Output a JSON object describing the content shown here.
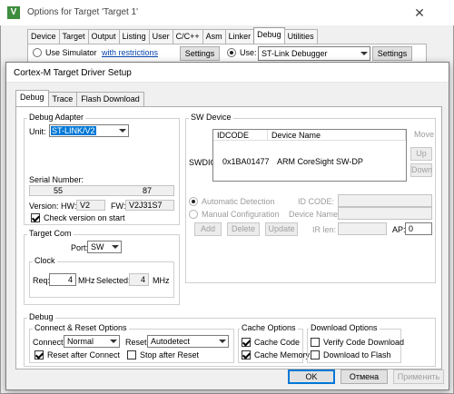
{
  "parent": {
    "title": "Options for Target 'Target 1'",
    "close": "✕",
    "tabs": [
      "Device",
      "Target",
      "Output",
      "Listing",
      "User",
      "C/C++",
      "Asm",
      "Linker",
      "Debug",
      "Utilities"
    ],
    "active_tab": "Debug",
    "use_simulator_label": "Use Simulator",
    "with_restrictions_link": "with restrictions",
    "settings_left": "Settings",
    "use_label": "Use:",
    "debugger": "ST-Link Debugger",
    "settings_right": "Settings"
  },
  "dialog": {
    "title": "Cortex-M Target Driver Setup",
    "tabs": [
      "Debug",
      "Trace",
      "Flash Download"
    ],
    "active_tab": "Debug",
    "debug_adapter": {
      "group": "Debug Adapter",
      "unit_label": "Unit:",
      "unit_value": "ST-LINK/V2",
      "serial_label": "Serial Number:",
      "serial_a": "55",
      "serial_b": "87",
      "version_label": "Version: HW:",
      "hw_value": "V2",
      "fw_label": "FW:",
      "fw_value": "V2J31S7",
      "check_version": "Check version on start"
    },
    "target_com": {
      "group": "Target Com",
      "port_label": "Port:",
      "port_value": "SW",
      "clock_group": "Clock",
      "req_label": "Req:",
      "req_value": "4",
      "mhz1": "MHz",
      "selected_label": "Selected:",
      "selected_value": "4",
      "mhz2": "MHz"
    },
    "sw_device": {
      "group": "SW Device",
      "swdio": "SWDIO",
      "col_idcode": "IDCODE",
      "col_device": "Device Name",
      "row_idcode": "0x1BA01477",
      "row_device": "ARM CoreSight SW-DP",
      "move": "Move",
      "up": "Up",
      "down": "Down",
      "auto_detect": "Automatic Detection",
      "manual_config": "Manual Configuration",
      "id_code_label": "ID CODE:",
      "device_name_label": "Device Name:",
      "ir_len_label": "IR len:",
      "ap_label": "AP:",
      "ap_value": "0",
      "add": "Add",
      "delete": "Delete",
      "update": "Update"
    },
    "debug": {
      "group": "Debug",
      "connect_reset_group": "Connect & Reset Options",
      "connect_label": "Connect:",
      "connect_value": "Normal",
      "reset_label": "Reset:",
      "reset_value": "Autodetect",
      "reset_after_connect": "Reset after Connect",
      "stop_after_reset": "Stop after Reset",
      "cache_group": "Cache Options",
      "cache_code": "Cache Code",
      "cache_memory": "Cache Memory",
      "download_group": "Download Options",
      "verify_code": "Verify Code Download",
      "download_flash": "Download to Flash"
    },
    "buttons": {
      "ok": "OK",
      "cancel": "Отмена",
      "apply": "Применить"
    }
  }
}
